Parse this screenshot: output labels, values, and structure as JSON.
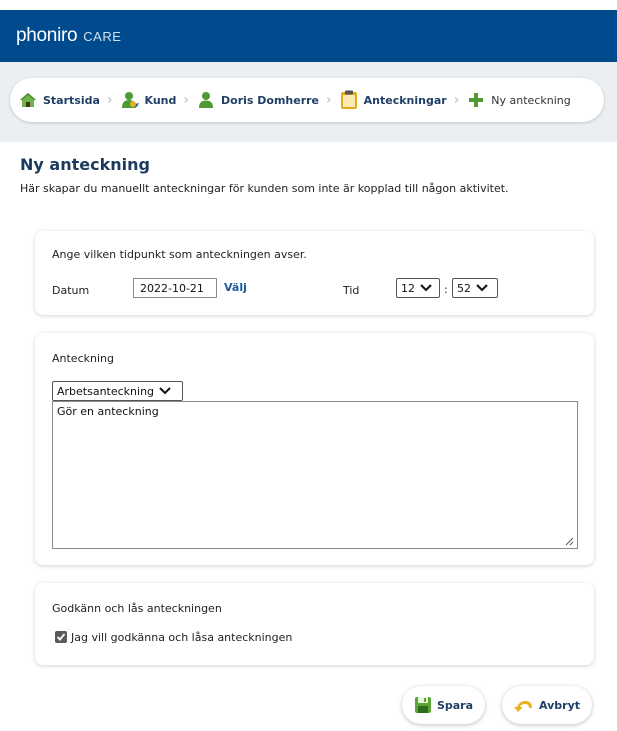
{
  "app": {
    "brand": "phoniro",
    "brand_suffix": "CARE"
  },
  "breadcrumb": {
    "items": [
      {
        "label": "Startsida",
        "icon": "home-icon"
      },
      {
        "label": "Kund",
        "icon": "customer-icon"
      },
      {
        "label": "Doris Domherre",
        "icon": "person-icon"
      },
      {
        "label": "Anteckningar",
        "icon": "clipboard-icon"
      },
      {
        "label": "Ny anteckning",
        "icon": "plus-icon"
      }
    ]
  },
  "page": {
    "title": "Ny anteckning",
    "description": "Här skapar du manuellt anteckningar för kunden som inte är kopplad till någon aktivitet."
  },
  "time_section": {
    "heading": "Ange vilken tidpunkt som anteckningen avser.",
    "date_label": "Datum",
    "date_value": "2022-10-21",
    "pick_label": "Välj",
    "time_label": "Tid",
    "hour_value": "12",
    "minute_value": "52",
    "time_separator": ":"
  },
  "note_section": {
    "heading": "Anteckning",
    "type_value": "Arbetsanteckning",
    "text": "Gör en anteckning"
  },
  "approve_section": {
    "heading": "Godkänn och lås anteckningen",
    "checkbox_label": "Jag vill godkänna och låsa anteckningen",
    "checked": true
  },
  "actions": {
    "save_label": "Spara",
    "cancel_label": "Avbryt"
  },
  "colors": {
    "header": "#004b8d",
    "title": "#1b3a5e",
    "link": "#1b5c9a",
    "background": "#eceff2"
  }
}
